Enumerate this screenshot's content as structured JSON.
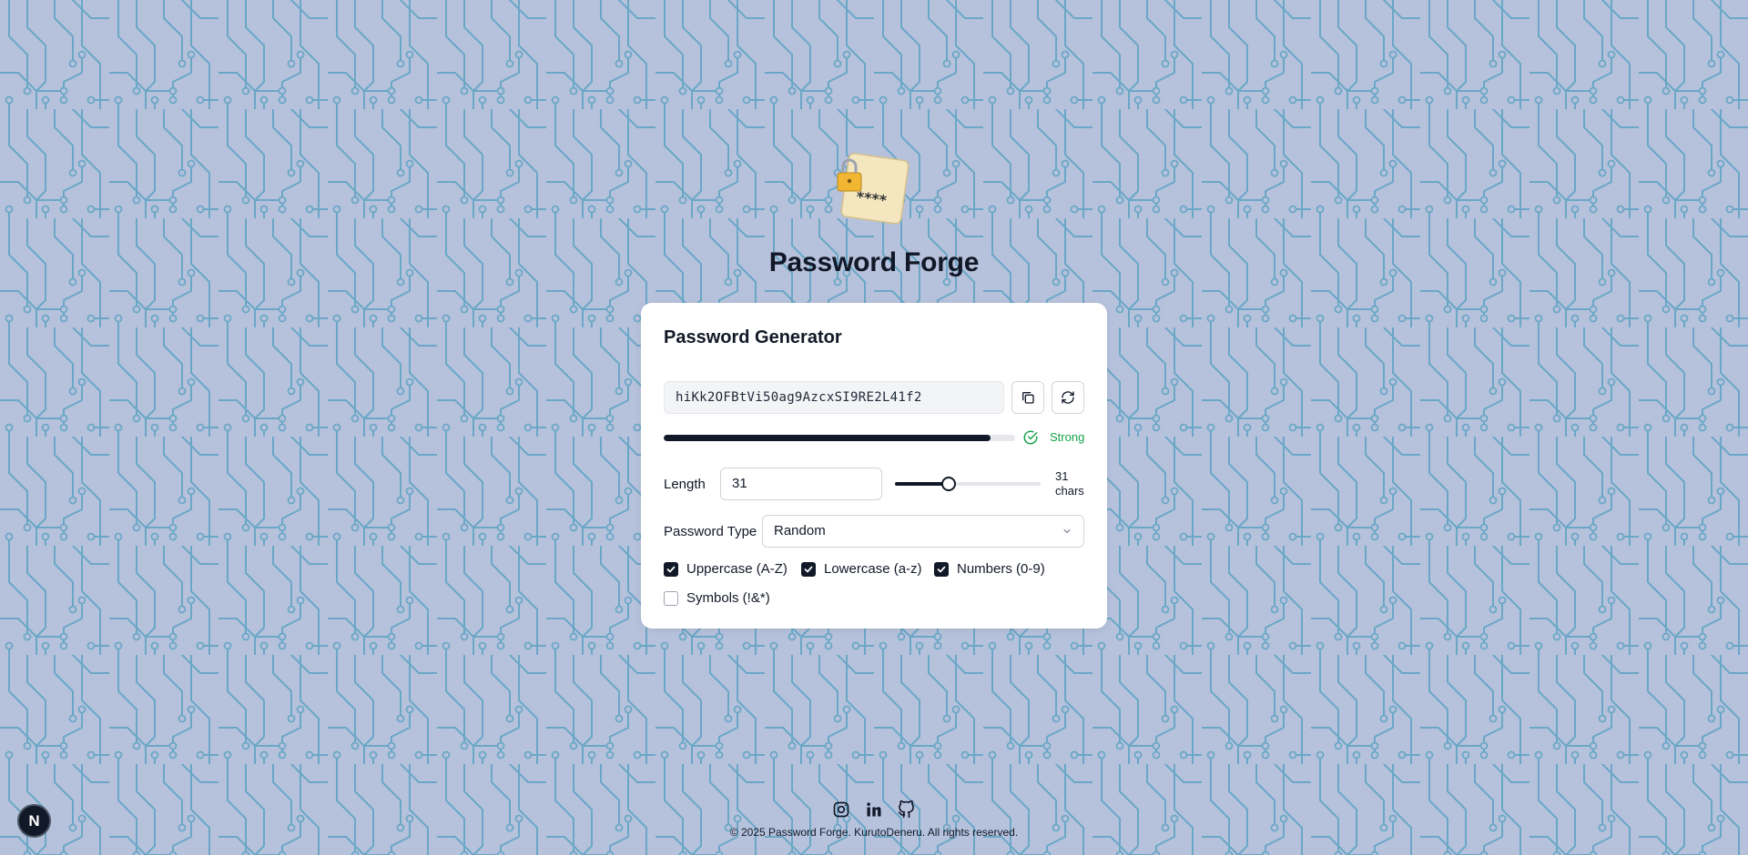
{
  "app": {
    "title": "Password Forge"
  },
  "card": {
    "title": "Password Generator",
    "password": "hiKk2OFBtVi50ag9AzcxSI9RE2L41f2",
    "strength_label": "Strong",
    "strength_level": 0.93
  },
  "length": {
    "label": "Length",
    "value": "31",
    "slider_fraction": 0.37,
    "chars_count": "31",
    "chars_unit": "chars"
  },
  "type": {
    "label": "Password Type",
    "selected": "Random"
  },
  "options": [
    {
      "label": "Uppercase (A-Z)",
      "checked": true
    },
    {
      "label": "Lowercase (a-z)",
      "checked": true
    },
    {
      "label": "Numbers (0-9)",
      "checked": true
    },
    {
      "label": "Symbols (!&*)",
      "checked": false
    }
  ],
  "footer": {
    "copyright": "© 2025 Password Forge. KurutoDeneru. All rights reserved."
  },
  "social_icons": [
    "instagram-icon",
    "linkedin-icon",
    "github-icon"
  ],
  "badge": {
    "letter": "N"
  },
  "colors": {
    "background": "#b6c2dc",
    "circuit": "#6aa7c6",
    "accent": "#111827",
    "strong": "#16a34a"
  }
}
